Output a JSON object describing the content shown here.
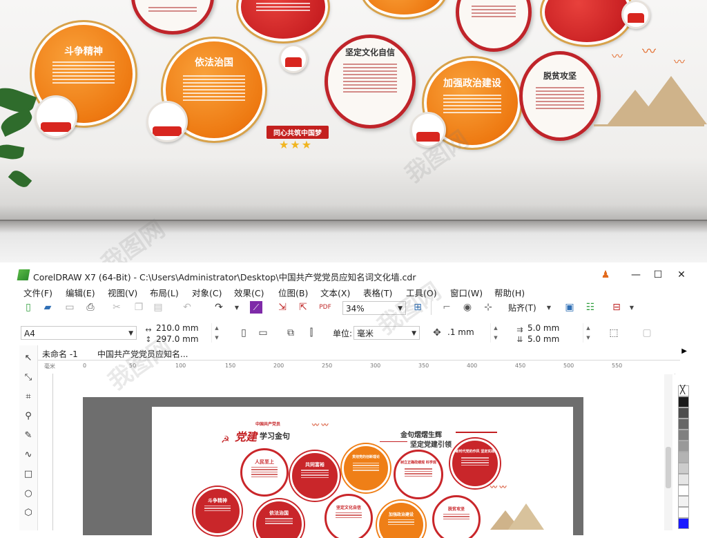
{
  "photo": {
    "circles": [
      {
        "title": "斗争精神"
      },
      {
        "title": "依法治国"
      },
      {
        "title": "坚定文化自信"
      },
      {
        "title": "加强政治建设"
      },
      {
        "title": "脱贫攻坚"
      }
    ],
    "ribbon": "同心共筑中国梦",
    "stars": "★★★",
    "watermark": "我图网"
  },
  "window": {
    "title": "CorelDRAW X7 (64-Bit) - C:\\Users\\Administrator\\Desktop\\中国共产党党员应知名词文化墙.cdr",
    "controls": {
      "minimize": "—",
      "maximize": "☐",
      "close": "✕"
    },
    "menu": [
      "文件(F)",
      "编辑(E)",
      "视图(V)",
      "布局(L)",
      "对象(C)",
      "效果(C)",
      "位图(B)",
      "文本(X)",
      "表格(T)",
      "工具(O)",
      "窗口(W)",
      "帮助(H)"
    ],
    "toolbar": {
      "zoom": "34%",
      "snap_label": "贴齐(T)"
    },
    "property_bar": {
      "page_size": "A4",
      "width": "210.0 mm",
      "height": "297.0 mm",
      "units_label": "单位:",
      "units": "毫米",
      "nudge": ".1 mm",
      "dup_x": "5.0 mm",
      "dup_y": "5.0 mm"
    },
    "tabs": [
      "未命名 -1",
      "中国共产党党员应知名..."
    ],
    "ruler_ticks": [
      "0",
      "50",
      "100",
      "150",
      "200",
      "250",
      "300",
      "350",
      "400",
      "450",
      "500",
      "550"
    ],
    "ruler_unit": "毫米",
    "page": {
      "header_small": "中国共产党员",
      "header_brand": "党建",
      "header_title": "学习金句",
      "right_title_1": "金句熠熠生辉",
      "right_title_2": "坚定党建引领",
      "circles": [
        {
          "title": "人民至上"
        },
        {
          "title": "共同富裕"
        },
        {
          "title": "贯彻党的创新理论"
        },
        {
          "title": "树立正确政绩观 科学观"
        },
        {
          "title": "新时代党的作风 坚定实践"
        },
        {
          "title": "斗争精神"
        },
        {
          "title": "依法治国"
        },
        {
          "title": "坚定文化自信"
        },
        {
          "title": "加强政治建设"
        },
        {
          "title": "脱贫攻坚"
        }
      ]
    },
    "palette": [
      "#ffffff",
      "#1a1a1a",
      "#4d4d4d",
      "#666666",
      "#808080",
      "#999999",
      "#b3b3b3",
      "#cccccc",
      "#e6e6e6",
      "#ffffff",
      "#f2f2f2",
      "#ffffff",
      "#e6e6e6",
      "#1a1aff"
    ]
  }
}
